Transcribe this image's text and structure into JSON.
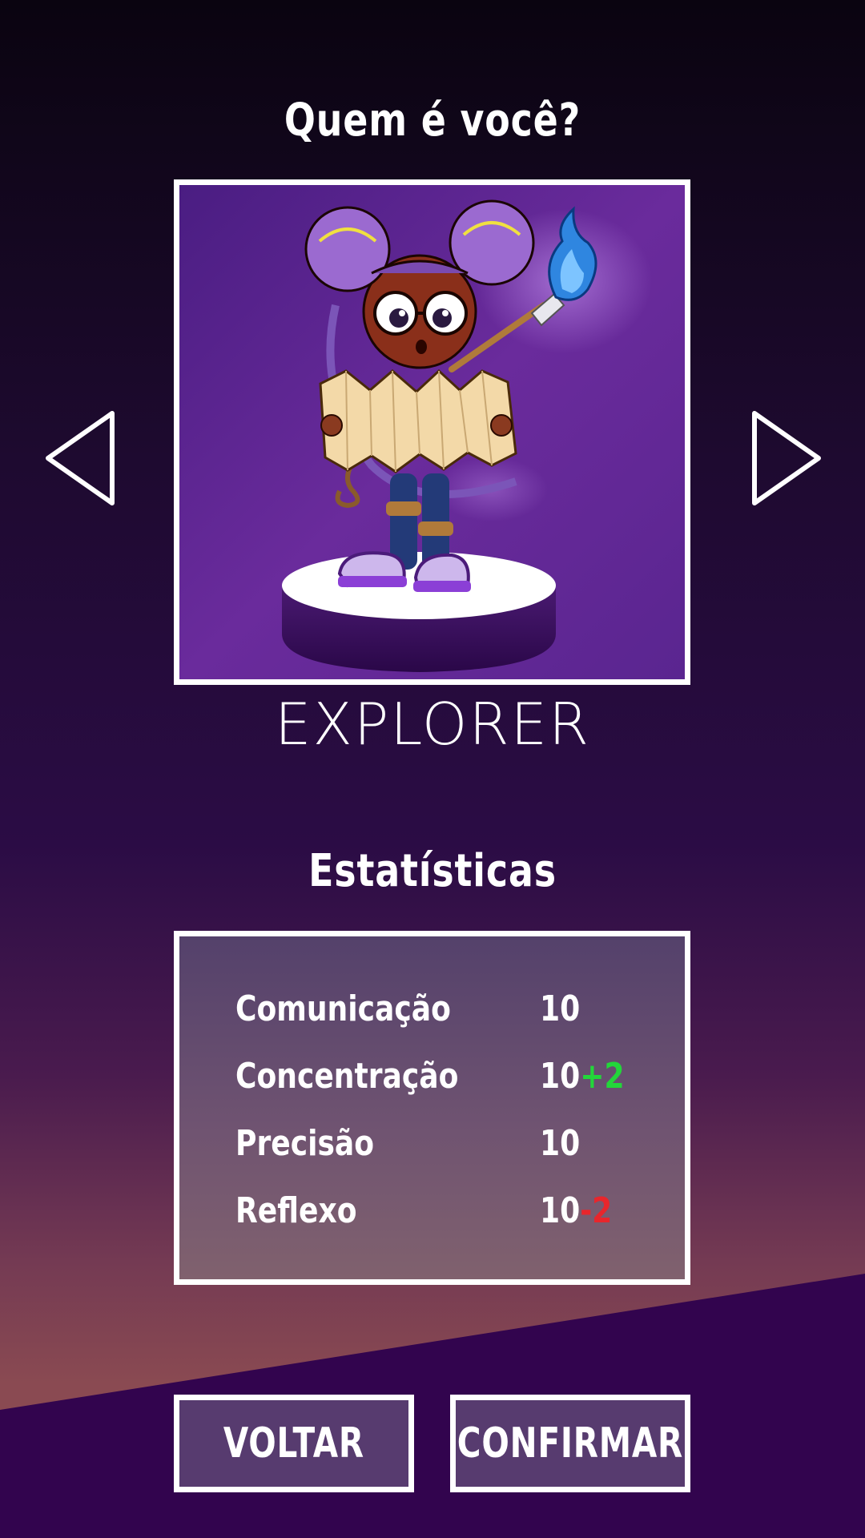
{
  "screen": {
    "title": "Quem é você?",
    "class_name": "EXPLORER",
    "stats_title": "Estatísticas"
  },
  "stats": [
    {
      "label": "Comunicação",
      "value": "10",
      "modifier": ""
    },
    {
      "label": "Concentração",
      "value": "10",
      "modifier": "+2"
    },
    {
      "label": "Precisão",
      "value": "10",
      "modifier": ""
    },
    {
      "label": "Reflexo",
      "value": "10",
      "modifier": "-2"
    }
  ],
  "buttons": {
    "back": "VOLTAR",
    "confirm": "CONFIRMAR"
  },
  "icons": {
    "prev": "triangle-left-icon",
    "next": "triangle-right-icon"
  },
  "colors": {
    "bg_top": "#0c0414",
    "bg_mid": "#2a0d42",
    "bg_sunset": "#8a4a52",
    "ground": "#32044e",
    "portrait_bg": "#5a2590",
    "bonus": "#23d63a",
    "penalty": "#e8262c",
    "button_fill": "#573b6f"
  }
}
